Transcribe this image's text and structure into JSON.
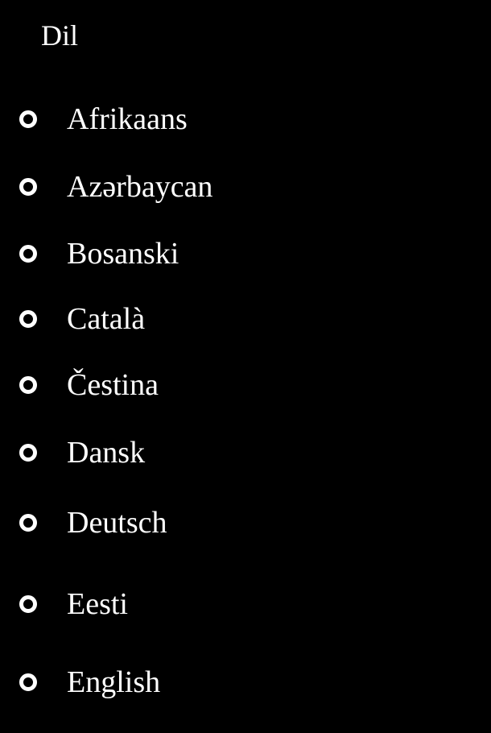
{
  "header": {
    "title": "Dil"
  },
  "languages": {
    "items": [
      {
        "label": "Afrikaans",
        "selected": false
      },
      {
        "label": "Azərbaycan",
        "selected": false
      },
      {
        "label": "Bosanski",
        "selected": false
      },
      {
        "label": "Català",
        "selected": false
      },
      {
        "label": "Čestina",
        "selected": false
      },
      {
        "label": "Dansk",
        "selected": false
      },
      {
        "label": "Deutsch",
        "selected": false
      },
      {
        "label": "Eesti",
        "selected": false
      },
      {
        "label": "English",
        "selected": false
      }
    ]
  },
  "colors": {
    "background": "#000000",
    "foreground": "#ffffff"
  }
}
